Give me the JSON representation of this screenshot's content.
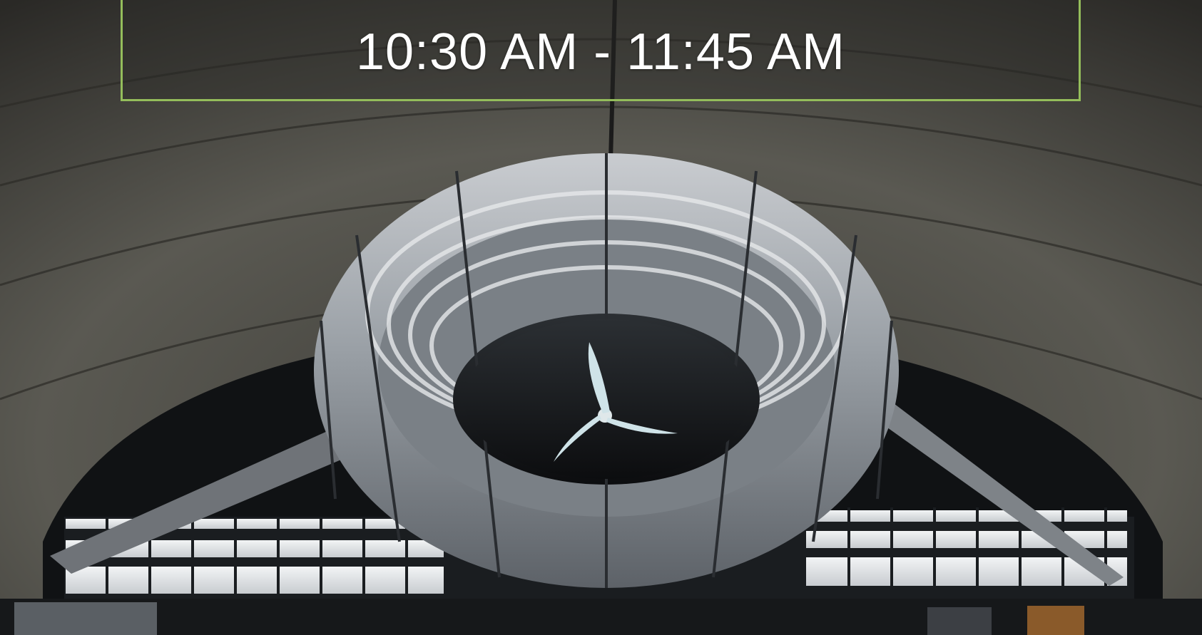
{
  "banner": {
    "time_range": "10:30 AM - 11:45 AM",
    "border_color": "#94bd5b",
    "text_color": "#ffffff"
  },
  "photo": {
    "subject": "inflatable airborne wind turbine ring in hangar",
    "icon": "turbine-photo"
  }
}
